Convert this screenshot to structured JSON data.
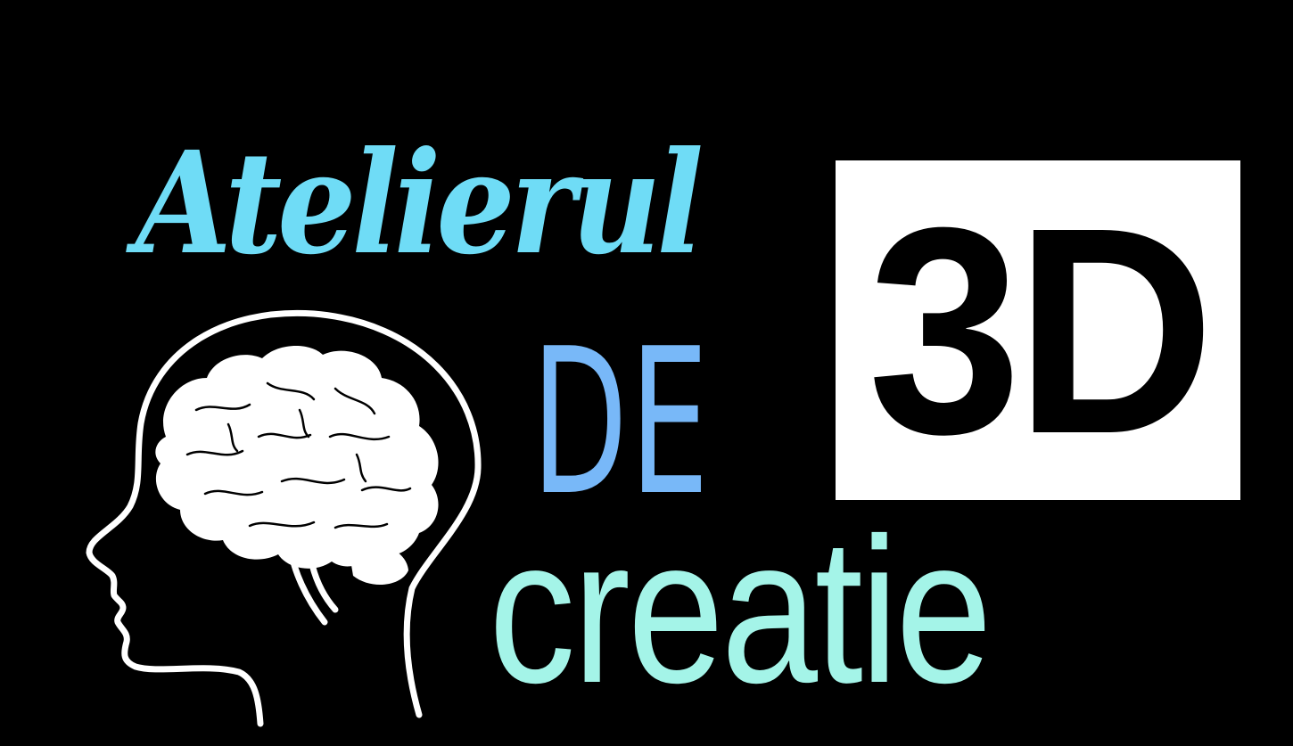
{
  "logo": {
    "word_1": "Atelierul",
    "word_2": "DE",
    "word_3": "creatie",
    "badge": "3D"
  },
  "colors": {
    "background": "#000000",
    "atelierul": "#6fdcf6",
    "de": "#78b8f8",
    "creatie": "#a4f4e8",
    "badge_fill": "#ffffff",
    "badge_text": "#000000",
    "illustration": "#ffffff"
  },
  "icons": {
    "illustration": "head-with-brain-icon"
  }
}
